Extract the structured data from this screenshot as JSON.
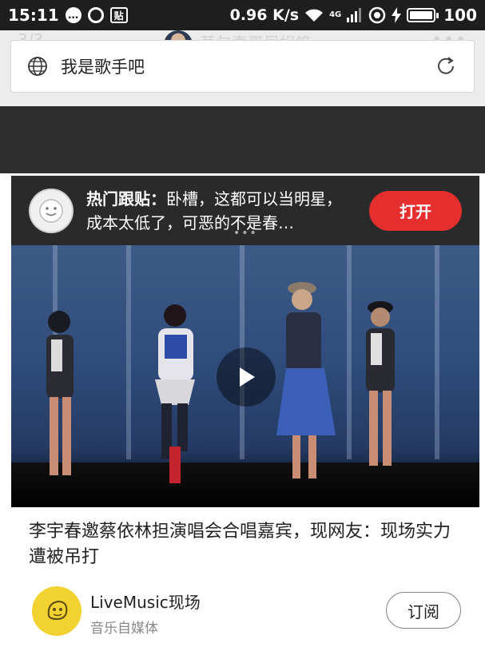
{
  "status_bar": {
    "time": "15:11",
    "tie_icon_label": "贴",
    "net_speed": "0.96 K/s",
    "network_label": "4G",
    "battery": "100"
  },
  "header": {
    "page_counter": "3/3",
    "author_overlay": "草包春哥凤姐笑",
    "more": "•••",
    "address_text": "我是歌手吧"
  },
  "hot_comment": {
    "label": "热门跟贴：",
    "text": "卧槽，这都可以当明星，成本太低了，可恶的不是春…",
    "open_label": "打开",
    "loading": "•••"
  },
  "article": {
    "title": "李宇春邀蔡依林担演唱会合唱嘉宾，现网友：现场实力遭被吊打",
    "source_name": "LiveMusic现场",
    "source_type": "音乐自媒体",
    "subscribe_label": "订阅"
  },
  "colors": {
    "accent_red": "#e52e2e",
    "logo_yellow": "#f2d230"
  }
}
